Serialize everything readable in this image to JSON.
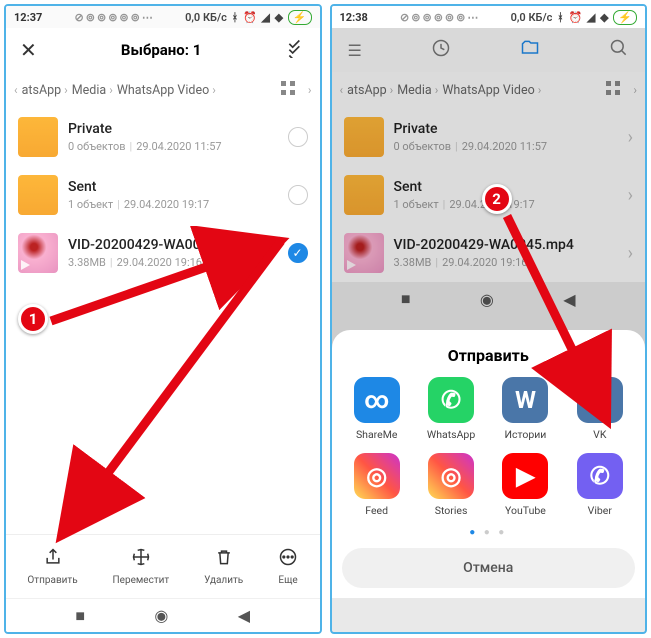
{
  "left": {
    "statusbar": {
      "time": "12:37",
      "data": "0,0 КБ/с"
    },
    "header": {
      "title": "Выбрано: 1"
    },
    "breadcrumb": {
      "seg1": "atsApp",
      "seg2": "Media",
      "seg3": "WhatsApp Video"
    },
    "files": [
      {
        "name": "Private",
        "meta1": "0 объектов",
        "meta2": "29.04.2020 11:57"
      },
      {
        "name": "Sent",
        "meta1": "1 объект",
        "meta2": "29.04.2020 19:17"
      },
      {
        "name": "VID-20200429-WA0045.mp4",
        "meta1": "3.38MB",
        "meta2": "29.04.2020 19:16"
      }
    ],
    "actions": {
      "send": "Отправить",
      "move": "Переместит",
      "delete": "Удалить",
      "more": "Еще"
    },
    "callout": "1"
  },
  "right": {
    "statusbar": {
      "time": "12:38",
      "data": "0,0 КБ/с"
    },
    "breadcrumb": {
      "seg1": "atsApp",
      "seg2": "Media",
      "seg3": "WhatsApp Video"
    },
    "files": [
      {
        "name": "Private",
        "meta1": "0 объектов",
        "meta2": "29.04.2020 11:57"
      },
      {
        "name": "Sent",
        "meta1": "1 объект",
        "meta2": "29.04.2020 19:17"
      },
      {
        "name": "VID-20200429-WA0045.mp4",
        "meta1": "3.38MB",
        "meta2": "29.04.2020 19:16"
      }
    ],
    "sheet": {
      "title": "Отправить",
      "apps": [
        {
          "label": "ShareMe",
          "bg": "#1e88e5",
          "glyph": "∞"
        },
        {
          "label": "WhatsApp",
          "bg": "#25d366",
          "glyph": "✆"
        },
        {
          "label": "Истории",
          "bg": "#4a76a8",
          "glyph": "W"
        },
        {
          "label": "VK",
          "bg": "#4a76a8",
          "glyph": "W"
        },
        {
          "label": "Feed",
          "bg": "linear-gradient(45deg,#fd5,#f54,#c3c)",
          "glyph": "◎"
        },
        {
          "label": "Stories",
          "bg": "linear-gradient(45deg,#fd5,#f54,#c3c)",
          "glyph": "◎"
        },
        {
          "label": "YouTube",
          "bg": "#ff0000",
          "glyph": "▶"
        },
        {
          "label": "Viber",
          "bg": "#7360f2",
          "glyph": "✆"
        }
      ],
      "cancel": "Отмена"
    },
    "callout": "2"
  }
}
